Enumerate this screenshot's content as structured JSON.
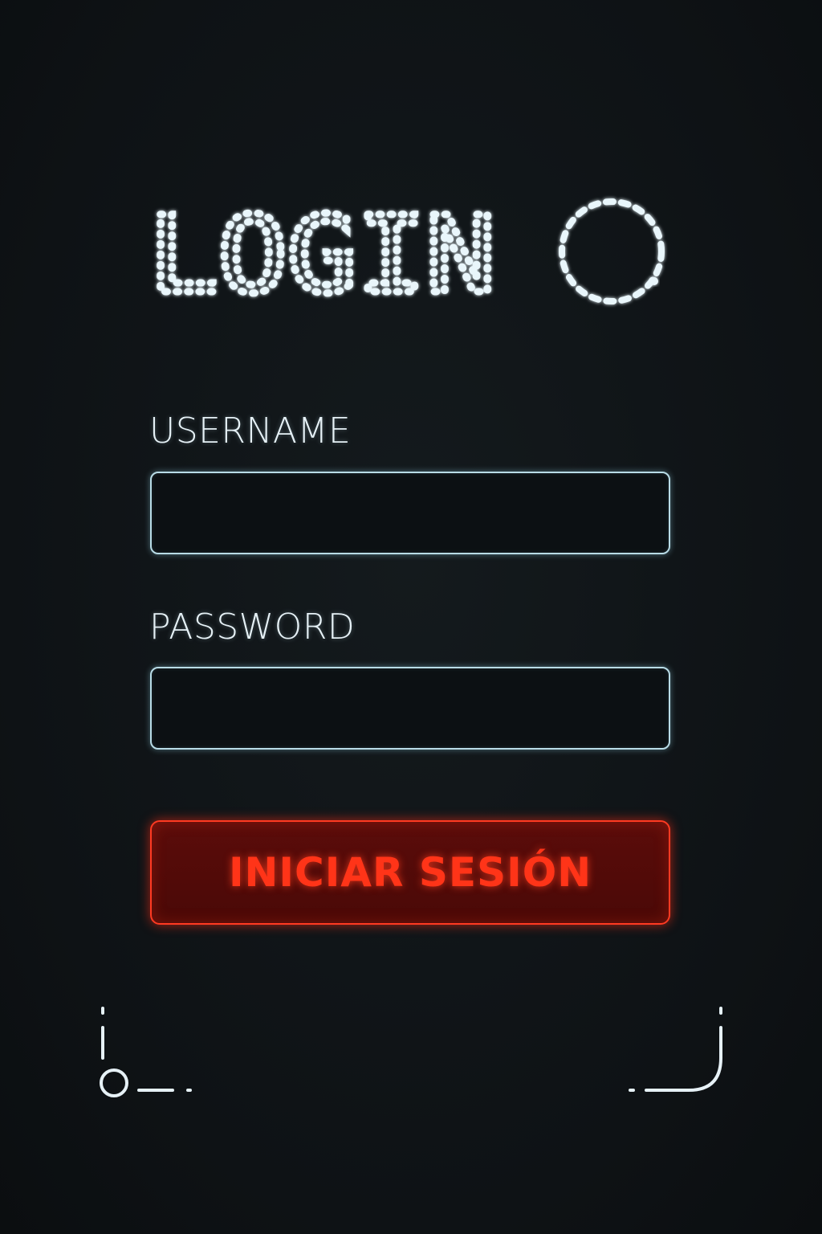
{
  "header": {
    "title": "LOGIN",
    "icon": "dotted-circle-icon"
  },
  "form": {
    "username": {
      "label": "USERNAME",
      "value": "",
      "placeholder": ""
    },
    "password": {
      "label": "PASSWORD",
      "value": "",
      "placeholder": ""
    },
    "submit_label": "INICIAR SESIÓN"
  },
  "decorations": {
    "left": "corner-bracket-circle-icon",
    "right": "corner-bracket-curve-icon"
  },
  "colors": {
    "background": "#0f1316",
    "text": "#e6f1f6",
    "field_border": "#b8dbe6",
    "accent": "#ff3418",
    "button_fill": "#5b0c0a"
  }
}
